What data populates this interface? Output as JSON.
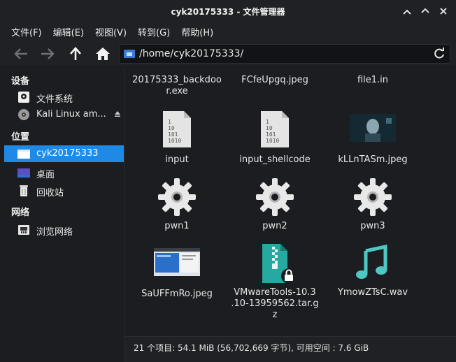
{
  "window": {
    "title": "cyk20175333 - 文件管理器"
  },
  "menu": [
    {
      "label": "文件(F)"
    },
    {
      "label": "编辑(E)"
    },
    {
      "label": "视图(V)"
    },
    {
      "label": "转到(G)"
    },
    {
      "label": "帮助(H)"
    }
  ],
  "toolbar": {
    "back_icon": "arrow-left-icon",
    "forward_icon": "arrow-right-icon",
    "up_icon": "arrow-up-icon",
    "home_icon": "home-icon"
  },
  "location": {
    "path": "/home/cyk20175333/",
    "reload_icon": "reload-icon"
  },
  "sidebar": {
    "devices_heading": "设备",
    "devices": [
      {
        "label": "文件系统",
        "icon": "drive-icon"
      },
      {
        "label": "Kali Linux am...",
        "icon": "disc-icon"
      }
    ],
    "places_heading": "位置",
    "places": [
      {
        "label": "cyk20175333",
        "icon": "home-folder-icon"
      },
      {
        "label": "桌面",
        "icon": "desktop-icon"
      },
      {
        "label": "回收站",
        "icon": "trash-icon"
      }
    ],
    "network_heading": "网络",
    "network": [
      {
        "label": "浏览网络",
        "icon": "network-icon"
      }
    ]
  },
  "files": [
    {
      "name": "20175333_backdoo\nr.exe",
      "icon": "none"
    },
    {
      "name": "FCfeUpgq.jpeg",
      "icon": "none"
    },
    {
      "name": "file1.in",
      "icon": "none"
    },
    {
      "name": "input",
      "icon": "binary-file-icon"
    },
    {
      "name": "input_shellcode",
      "icon": "binary-file-icon"
    },
    {
      "name": "kLLnTASm.jpeg",
      "icon": "image-thumbnail-icon"
    },
    {
      "name": "pwn1",
      "icon": "gear-icon"
    },
    {
      "name": "pwn2",
      "icon": "gear-icon"
    },
    {
      "name": "pwn3",
      "icon": "gear-icon"
    },
    {
      "name": "SaUFFmRo.jpeg",
      "icon": "image-thumbnail-icon"
    },
    {
      "name": "VMwareTools-10.3\n.10-13959562.tar.g\nz",
      "icon": "archive-lock-icon"
    },
    {
      "name": "YmowZTsC.wav",
      "icon": "music-note-icon"
    }
  ],
  "status": {
    "text": "21 个项目: 54.1 MiB (56,702,669 字节), 可用空间 : 7.6 GiB"
  },
  "colors": {
    "accent": "#1e8ae6",
    "music": "#4fc7c4",
    "archive": "#27a8a0",
    "gear": "#e8e8e8"
  }
}
